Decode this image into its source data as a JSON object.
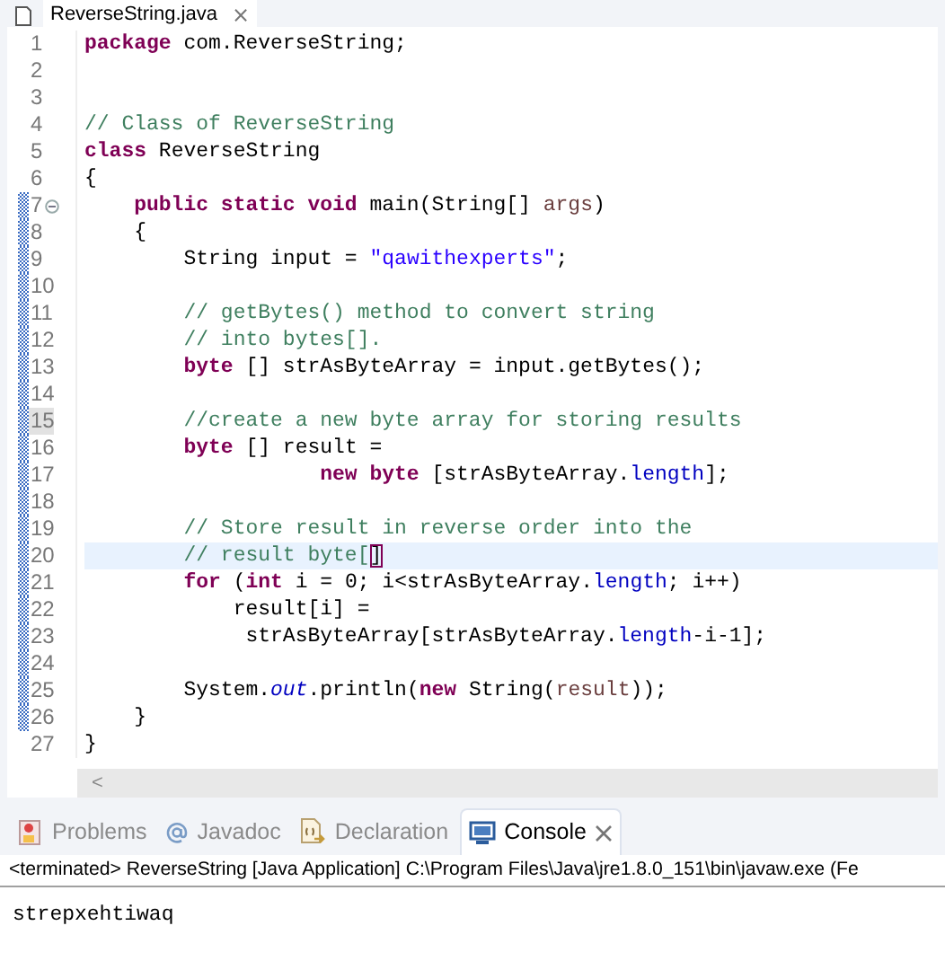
{
  "editor_tab": {
    "title": "ReverseString.java",
    "close_icon": "⨯"
  },
  "lines": [
    {
      "number": "1",
      "changed": false,
      "current": false,
      "marked": false,
      "foldable": false,
      "tokens": [
        {
          "kind": "kw",
          "text": "package"
        },
        {
          "kind": "plain",
          "text": " com.ReverseString;"
        }
      ]
    },
    {
      "number": "2",
      "changed": false,
      "current": false,
      "marked": false,
      "foldable": false
    },
    {
      "number": "3",
      "changed": false,
      "current": false,
      "marked": false,
      "foldable": false
    },
    {
      "number": "4",
      "changed": false,
      "current": false,
      "marked": false,
      "foldable": false,
      "tokens": [
        {
          "kind": "comment",
          "text": "// Class of ReverseString"
        }
      ]
    },
    {
      "number": "5",
      "changed": false,
      "current": false,
      "marked": false,
      "foldable": false,
      "tokens": [
        {
          "kind": "kw",
          "text": "class"
        },
        {
          "kind": "plain",
          "text": " ReverseString"
        }
      ]
    },
    {
      "number": "6",
      "changed": false,
      "current": false,
      "marked": false,
      "foldable": false,
      "tokens": [
        {
          "kind": "plain",
          "text": "{"
        }
      ]
    },
    {
      "number": "7",
      "changed": true,
      "current": false,
      "marked": false,
      "foldable": true,
      "tokens": [
        {
          "kind": "kw",
          "text": "    public static void"
        },
        {
          "kind": "plain",
          "text": " main(String[] "
        },
        {
          "kind": "var",
          "text": "args"
        },
        {
          "kind": "plain",
          "text": ")"
        }
      ]
    },
    {
      "number": "8",
      "changed": true,
      "current": false,
      "marked": false,
      "foldable": false,
      "tokens": [
        {
          "kind": "plain",
          "text": "    {"
        }
      ]
    },
    {
      "number": "9",
      "changed": true,
      "current": false,
      "marked": false,
      "foldable": false,
      "tokens": [
        {
          "kind": "plain",
          "text": "        String input = "
        },
        {
          "kind": "string",
          "text": "\"qawithexperts\""
        },
        {
          "kind": "plain",
          "text": ";"
        }
      ]
    },
    {
      "number": "10",
      "changed": true,
      "current": false,
      "marked": false,
      "foldable": false
    },
    {
      "number": "11",
      "changed": true,
      "current": false,
      "marked": false,
      "foldable": false,
      "tokens": [
        {
          "kind": "comment",
          "text": "        // getBytes() method to convert string"
        }
      ]
    },
    {
      "number": "12",
      "changed": true,
      "current": false,
      "marked": false,
      "foldable": false,
      "tokens": [
        {
          "kind": "comment",
          "text": "        // into bytes[]."
        }
      ]
    },
    {
      "number": "13",
      "changed": true,
      "current": false,
      "marked": false,
      "foldable": false,
      "tokens": [
        {
          "kind": "kw",
          "text": "        byte"
        },
        {
          "kind": "plain",
          "text": " [] strAsByteArray = input.getBytes();"
        }
      ]
    },
    {
      "number": "14",
      "changed": true,
      "current": false,
      "marked": false,
      "foldable": false
    },
    {
      "number": "15",
      "changed": true,
      "current": false,
      "marked": true,
      "foldable": false,
      "tokens": [
        {
          "kind": "comment",
          "text": "        //create a new byte array for storing results"
        }
      ]
    },
    {
      "number": "16",
      "changed": true,
      "current": false,
      "marked": false,
      "foldable": false,
      "tokens": [
        {
          "kind": "kw",
          "text": "        byte"
        },
        {
          "kind": "plain",
          "text": " [] result ="
        }
      ]
    },
    {
      "number": "17",
      "changed": true,
      "current": false,
      "marked": false,
      "foldable": false,
      "tokens": [
        {
          "kind": "kw",
          "text": "                   new byte"
        },
        {
          "kind": "plain",
          "text": " [strAsByteArray."
        },
        {
          "kind": "field",
          "text": "length"
        },
        {
          "kind": "plain",
          "text": "];"
        }
      ]
    },
    {
      "number": "18",
      "changed": true,
      "current": false,
      "marked": false,
      "foldable": false
    },
    {
      "number": "19",
      "changed": true,
      "current": false,
      "marked": false,
      "foldable": false,
      "tokens": [
        {
          "kind": "comment",
          "text": "        // Store result in reverse order into the"
        }
      ]
    },
    {
      "number": "20",
      "changed": true,
      "current": true,
      "marked": false,
      "foldable": false,
      "tokens": [
        {
          "kind": "comment",
          "text": "        // result byte["
        },
        {
          "kind": "bracket",
          "text": "]"
        }
      ]
    },
    {
      "number": "21",
      "changed": true,
      "current": false,
      "marked": false,
      "foldable": false,
      "tokens": [
        {
          "kind": "kw",
          "text": "        for"
        },
        {
          "kind": "plain",
          "text": " ("
        },
        {
          "kind": "kw",
          "text": "int"
        },
        {
          "kind": "plain",
          "text": " i = 0; i<strAsByteArray."
        },
        {
          "kind": "field",
          "text": "length"
        },
        {
          "kind": "plain",
          "text": "; i++)"
        }
      ]
    },
    {
      "number": "22",
      "changed": true,
      "current": false,
      "marked": false,
      "foldable": false,
      "tokens": [
        {
          "kind": "plain",
          "text": "            result[i] ="
        }
      ]
    },
    {
      "number": "23",
      "changed": true,
      "current": false,
      "marked": false,
      "foldable": false,
      "tokens": [
        {
          "kind": "plain",
          "text": "             strAsByteArray[strAsByteArray."
        },
        {
          "kind": "field",
          "text": "length"
        },
        {
          "kind": "plain",
          "text": "-i-1];"
        }
      ]
    },
    {
      "number": "24",
      "changed": true,
      "current": false,
      "marked": false,
      "foldable": false
    },
    {
      "number": "25",
      "changed": true,
      "current": false,
      "marked": false,
      "foldable": false,
      "tokens": [
        {
          "kind": "plain",
          "text": "        System."
        },
        {
          "kind": "static",
          "text": "out"
        },
        {
          "kind": "plain",
          "text": ".println("
        },
        {
          "kind": "kw",
          "text": "new"
        },
        {
          "kind": "plain",
          "text": " String("
        },
        {
          "kind": "var",
          "text": "result"
        },
        {
          "kind": "plain",
          "text": "));"
        }
      ]
    },
    {
      "number": "26",
      "changed": true,
      "current": false,
      "marked": false,
      "foldable": false,
      "tokens": [
        {
          "kind": "plain",
          "text": "    }"
        }
      ]
    },
    {
      "number": "27",
      "changed": false,
      "current": false,
      "marked": false,
      "foldable": false,
      "tokens": [
        {
          "kind": "plain",
          "text": "}"
        }
      ]
    }
  ],
  "scrollbar": {
    "arrow": "<"
  },
  "panel_tabs": [
    {
      "kind": "problems",
      "label": "Problems",
      "selected": false
    },
    {
      "kind": "javadoc",
      "label": "Javadoc",
      "selected": false
    },
    {
      "kind": "declaration",
      "label": "Declaration",
      "selected": false
    },
    {
      "kind": "console",
      "label": "Console",
      "selected": true
    }
  ],
  "console": {
    "header": "<terminated> ReverseString [Java Application] C:\\Program Files\\Java\\jre1.8.0_151\\bin\\javaw.exe (Fe",
    "output": "strepxehtiwaq"
  }
}
